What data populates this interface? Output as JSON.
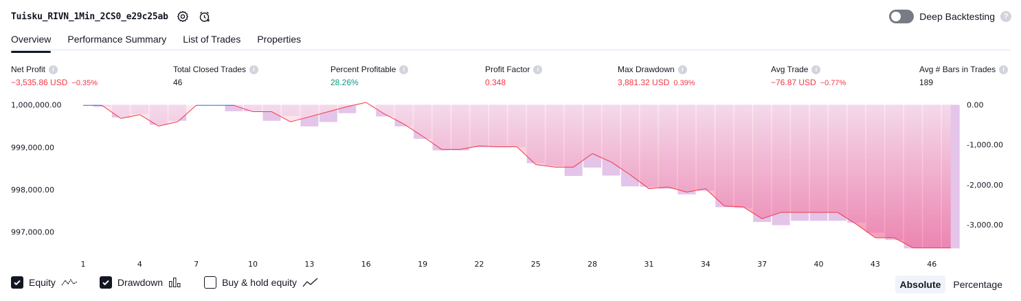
{
  "header": {
    "title": "Tuisku_RIVN_1Min_2CS0_e29c25ab",
    "deep_backtesting_label": "Deep Backtesting",
    "deep_backtesting_enabled": false
  },
  "tabs": [
    {
      "label": "Overview",
      "active": true
    },
    {
      "label": "Performance Summary",
      "active": false
    },
    {
      "label": "List of Trades",
      "active": false
    },
    {
      "label": "Properties",
      "active": false
    }
  ],
  "metrics": {
    "net_profit": {
      "label": "Net Profit",
      "value": "−3,535.86 USD",
      "pct": "−0.35%"
    },
    "total_closed_trades": {
      "label": "Total Closed Trades",
      "value": "46"
    },
    "percent_profitable": {
      "label": "Percent Profitable",
      "value": "28.26%"
    },
    "profit_factor": {
      "label": "Profit Factor",
      "value": "0.348"
    },
    "max_drawdown": {
      "label": "Max Drawdown",
      "value": "3,881.32 USD",
      "pct": "0.39%"
    },
    "avg_trade": {
      "label": "Avg Trade",
      "value": "−76.87 USD",
      "pct": "−0.77%"
    },
    "avg_bars": {
      "label": "Avg # Bars in Trades",
      "value": "189"
    }
  },
  "colors": {
    "red": "#f23645",
    "green": "#089981",
    "equity_line_loss": "#f23645",
    "equity_line_gain": "#2962ff",
    "drawdown_bar": "#e1bee7",
    "area_gradient_top": "#f8bbd0",
    "area_gradient_bottom": "#f06292"
  },
  "chart_data": {
    "type": "area",
    "x_ticks": [
      "1",
      "4",
      "7",
      "10",
      "13",
      "16",
      "19",
      "22",
      "25",
      "28",
      "31",
      "34",
      "37",
      "40",
      "43",
      "46"
    ],
    "left_axis": {
      "ticks": [
        "1,000,000.00",
        "999,000.00",
        "998,000.00",
        "997,000.00"
      ],
      "ylim": [
        996600,
        1000060
      ]
    },
    "right_axis": {
      "ticks": [
        "0.00",
        "-1,000.00",
        "-2,000.00",
        "-3,000.00"
      ],
      "ylim": [
        -3600,
        60
      ]
    },
    "series": [
      {
        "name": "Equity",
        "x": [
          1,
          2,
          3,
          4,
          5,
          6,
          7,
          8,
          9,
          10,
          11,
          12,
          13,
          14,
          15,
          16,
          17,
          18,
          19,
          20,
          21,
          22,
          23,
          24,
          25,
          26,
          27,
          28,
          29,
          30,
          31,
          32,
          33,
          34,
          35,
          36,
          37,
          38,
          39,
          40,
          41,
          42,
          43,
          44,
          45,
          46,
          47
        ],
        "values": [
          999990,
          999990,
          999680,
          999770,
          999500,
          999600,
          999990,
          999990,
          999990,
          999840,
          999840,
          999600,
          999720,
          999840,
          999960,
          1000060,
          999780,
          999550,
          999260,
          998950,
          998950,
          999030,
          999010,
          999010,
          998590,
          998530,
          998530,
          998850,
          998650,
          998350,
          998020,
          998060,
          997940,
          998020,
          997610,
          997590,
          997310,
          997460,
          997460,
          997460,
          997460,
          997180,
          996860,
          996860,
          996620,
          996620,
          996620
        ]
      },
      {
        "name": "Drawdown",
        "x": [
          1,
          2,
          3,
          4,
          5,
          6,
          7,
          8,
          9,
          10,
          11,
          12,
          13,
          14,
          15,
          16,
          17,
          18,
          19,
          20,
          21,
          22,
          23,
          24,
          25,
          26,
          27,
          28,
          29,
          30,
          31,
          32,
          33,
          34,
          35,
          36,
          37,
          38,
          39,
          40,
          41,
          42,
          43,
          44,
          45,
          46,
          47
        ],
        "values": [
          0,
          -50,
          -320,
          -230,
          -500,
          -400,
          0,
          0,
          -160,
          -160,
          -400,
          -280,
          -540,
          -430,
          -210,
          0,
          -290,
          -540,
          -850,
          -1140,
          -1140,
          -1060,
          -1060,
          -1060,
          -1460,
          -1520,
          -1780,
          -1570,
          -1770,
          -2040,
          -2050,
          -2100,
          -2240,
          -2150,
          -2560,
          -2580,
          -2930,
          -3010,
          -2900,
          -2900,
          -2900,
          -2950,
          -3200,
          -3380,
          -3590,
          -3590,
          -3590
        ]
      }
    ]
  },
  "legend": {
    "equity": {
      "label": "Equity",
      "checked": true
    },
    "drawdown": {
      "label": "Drawdown",
      "checked": true
    },
    "buy_hold": {
      "label": "Buy & hold equity",
      "checked": false
    }
  },
  "mode": {
    "absolute": "Absolute",
    "percentage": "Percentage",
    "selected": "absolute"
  }
}
